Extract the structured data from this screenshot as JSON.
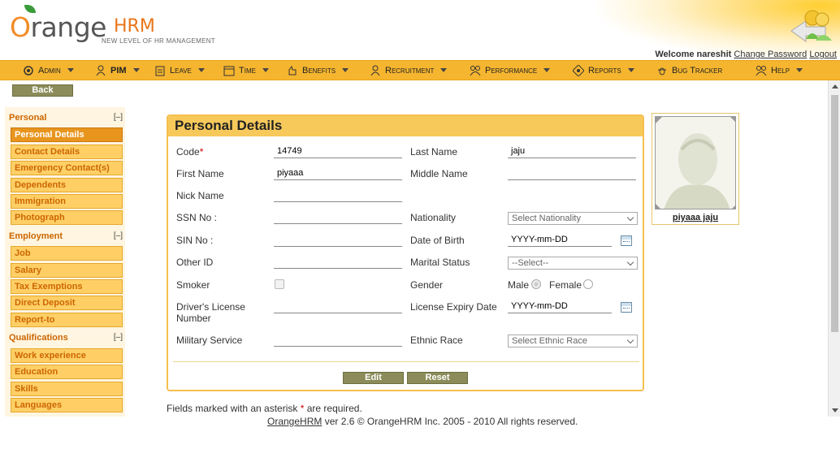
{
  "brand": {
    "word_o": "O",
    "word": "range",
    "hrm": "HRM",
    "tagline": "NEW LEVEL OF HR MANAGEMENT"
  },
  "header": {
    "welcome": "Welcome nareshit",
    "change_password": "Change Password",
    "logout": "Logout"
  },
  "menu": [
    {
      "label": "Admin",
      "icon": "admin-gear-icon"
    },
    {
      "label": "PIM",
      "icon": "pim-person-icon"
    },
    {
      "label": "Leave",
      "icon": "leave-clipboard-icon"
    },
    {
      "label": "Time",
      "icon": "time-calendar-icon"
    },
    {
      "label": "Benefits",
      "icon": "benefits-hand-icon"
    },
    {
      "label": "Recruitment",
      "icon": "recruitment-person-icon"
    },
    {
      "label": "Performance",
      "icon": "performance-people-icon"
    },
    {
      "label": "Reports",
      "icon": "reports-gear-icon"
    },
    {
      "label": "Bug Tracker",
      "icon": "bug-icon"
    },
    {
      "label": "Help",
      "icon": "help-people-icon"
    }
  ],
  "back_label": "Back",
  "sidenav": {
    "sections": [
      {
        "title": "Personal",
        "toggle": "[–]",
        "items": [
          "Personal Details",
          "Contact Details",
          "Emergency Contact(s)",
          "Dependents",
          "Immigration",
          "Photograph"
        ]
      },
      {
        "title": "Employment",
        "toggle": "[–]",
        "items": [
          "Job",
          "Salary",
          "Tax Exemptions",
          "Direct Deposit",
          "Report-to"
        ]
      },
      {
        "title": "Qualifications",
        "toggle": "[–]",
        "items": [
          "Work experience",
          "Education",
          "Skills",
          "Languages"
        ]
      }
    ],
    "active": "Personal Details"
  },
  "form": {
    "title": "Personal Details",
    "code_label": "Code",
    "code_value": "14749",
    "last_name_label": "Last Name",
    "last_name_value": "jaju",
    "first_name_label": "First Name",
    "first_name_value": "piyaaa",
    "middle_name_label": "Middle Name",
    "middle_name_value": "",
    "nick_name_label": "Nick Name",
    "nick_name_value": "",
    "ssn_label": "SSN No :",
    "ssn_value": "",
    "nationality_label": "Nationality",
    "nationality_value": "Select Nationality",
    "sin_label": "SIN No :",
    "sin_value": "",
    "dob_label": "Date of Birth",
    "dob_value": "YYYY-mm-DD",
    "other_id_label": "Other ID",
    "other_id_value": "",
    "marital_label": "Marital Status",
    "marital_value": "--Select--",
    "smoker_label": "Smoker",
    "gender_label": "Gender",
    "gender_male": "Male",
    "gender_female": "Female",
    "license_label_1": "Driver's License",
    "license_label_2": "Number",
    "license_value": "",
    "license_expiry_label": "License Expiry Date",
    "license_expiry_value": "YYYY-mm-DD",
    "military_label": "Military Service",
    "military_value": "",
    "ethnic_label": "Ethnic Race",
    "ethnic_value": "Select Ethnic Race",
    "edit_label": "Edit",
    "reset_label": "Reset"
  },
  "photo": {
    "name": "piyaaa jaju"
  },
  "footer": {
    "note_pre": "Fields marked with an asterisk",
    "note_star": "*",
    "note_post": "are required.",
    "brand_link": "OrangeHRM",
    "copyright": "ver 2.6 © OrangeHRM Inc. 2005 - 2010 All rights reserved."
  },
  "colors": {
    "menu_bg": "#f5b52f",
    "nav_item_bg": "#ffcf66",
    "nav_active_bg": "#e8951e",
    "panel_head": "#f7c95a",
    "button_bg": "#8c8c5a",
    "accent_orange": "#cc6600"
  }
}
